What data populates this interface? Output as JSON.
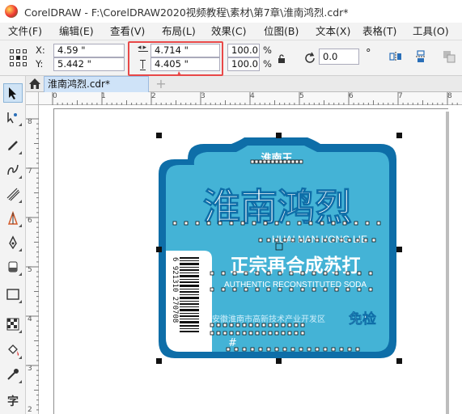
{
  "title_bar": {
    "title": "CorelDRAW - F:\\CorelDRAW2020视频教程\\素材\\第7章\\淮南鸿烈.cdr*"
  },
  "menu": {
    "items": [
      "文件(F)",
      "编辑(E)",
      "查看(V)",
      "布局(L)",
      "效果(C)",
      "位图(B)",
      "文本(X)",
      "表格(T)",
      "工具(O)"
    ]
  },
  "property_bar": {
    "x_label": "X:",
    "x_value": "4.59 \"",
    "y_label": "Y:",
    "y_value": "5.442 \"",
    "width_value": "4.714 \"",
    "height_value": "4.405 \"",
    "scale_x": "100.0",
    "scale_y": "100.0",
    "scale_unit": "%",
    "rotation_value": "0.0",
    "rotation_unit": "°"
  },
  "doc_tabs": {
    "active": "淮南鸿烈.cdr*",
    "add_symbol": "+"
  },
  "toolbox": {
    "text_tool_glyph": "字"
  },
  "rulers": {
    "top_ticks": [
      "0",
      "1",
      "2",
      "3",
      "4",
      "5",
      "6",
      "7",
      "8"
    ],
    "left_ticks": [
      "8",
      "7",
      "6",
      "5",
      "4",
      "3",
      "2"
    ]
  },
  "label": {
    "brand_tag": "淮南王",
    "title": "淮南鸿烈",
    "pinyin": "HUAI NAN HONG LIE",
    "subtitle": "正宗再合成苏打",
    "english": "AUTHENTIC RECONSTITUTED SODA",
    "free_check": "免检",
    "barcode_number": "6 921310 270708",
    "bottom_text": "安徽淮南市高新技术产业开发区",
    "hash": "#"
  },
  "colors": {
    "label_dark_blue": "#0e6ea8",
    "label_light_blue": "#44b3d6",
    "highlight_red": "#e84848"
  }
}
